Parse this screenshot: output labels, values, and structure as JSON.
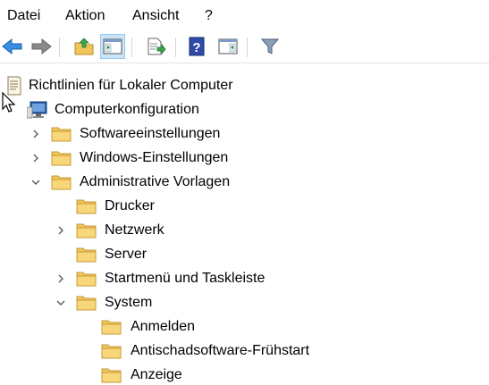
{
  "menu": {
    "items": [
      "Datei",
      "Aktion",
      "Ansicht",
      "?"
    ]
  },
  "toolbar": {
    "buttons": [
      "back-icon",
      "forward-icon",
      "up-folder-icon",
      "show-hide-console-tree-icon",
      "export-list-icon",
      "help-icon",
      "show-hide-action-pane-icon",
      "filter-icon"
    ],
    "active": "show-hide-console-tree-icon"
  },
  "tree": {
    "root": {
      "label": "Richtlinien für Lokaler Computer"
    },
    "computer": {
      "label": "Computerkonfiguration"
    },
    "software": {
      "label": "Softwareeinstellungen",
      "expanded": false
    },
    "windows": {
      "label": "Windows-Einstellungen",
      "expanded": false
    },
    "admin": {
      "label": "Administrative Vorlagen",
      "expanded": true
    },
    "drucker": {
      "label": "Drucker"
    },
    "netzwerk": {
      "label": "Netzwerk",
      "expanded": false
    },
    "server": {
      "label": "Server"
    },
    "startmenu": {
      "label": "Startmenü und Taskleiste",
      "expanded": false
    },
    "system": {
      "label": "System",
      "expanded": true
    },
    "anmelden": {
      "label": "Anmelden"
    },
    "antischad": {
      "label": "Antischadsoftware-Frühstart"
    },
    "anzeige": {
      "label": "Anzeige"
    }
  },
  "colors": {
    "folder": "#f0c65a",
    "folder_dark": "#d9a53a",
    "selected_button_bg": "#cce4f7",
    "chevron": "#5a5a5a"
  }
}
